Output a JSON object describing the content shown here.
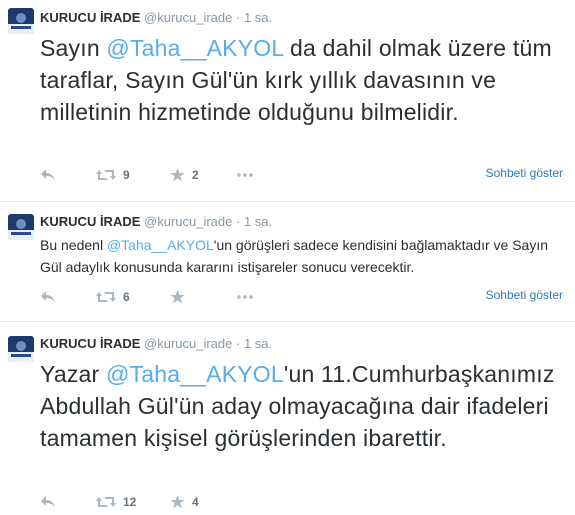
{
  "tweets": [
    {
      "name": "KURUCU İRADE",
      "handle": "@kurucu_irade",
      "separator": "·",
      "time": "1 sa.",
      "text_before": "Sayın ",
      "mention": "@Taha__AKYOL",
      "text_after": " da dahil olmak üzere tüm taraflar, Sayın Gül'ün kırk yıllık davasının ve milletinin hizmetinde olduğunu bilmelidir.",
      "retweets": "9",
      "favorites": "2",
      "expand_label": "Sohbeti göster"
    },
    {
      "name": "KURUCU İRADE",
      "handle": "@kurucu_irade",
      "separator": "·",
      "time": "1 sa.",
      "text_before": "Bu nedenl ",
      "mention": "@Taha__AKYOL",
      "text_after": "'un görüşleri sadece kendisini bağlamaktadır ve Sayın Gül adaylık konusunda kararını istişareler sonucu verecektir.",
      "retweets": "6",
      "favorites": "",
      "expand_label": "Sohbeti göster"
    },
    {
      "name": "KURUCU İRADE",
      "handle": "@kurucu_irade",
      "separator": "·",
      "time": "1 sa.",
      "text_before": "Yazar ",
      "mention": "@Taha__AKYOL",
      "text_after": "'un 11.Cumhurbaşkanımız Abdullah Gül'ün aday olmayacağına dair ifadeleri tamamen kişisel görüşlerinden ibarettir.",
      "retweets": "12",
      "favorites": "4",
      "expand_label": ""
    }
  ],
  "colors": {
    "mention": "#55acee",
    "link": "#2b7bb9",
    "icon": "#aab8c2",
    "separator": "#e1e8ed"
  },
  "icons": [
    "reply-icon",
    "retweet-icon",
    "favorite-icon",
    "more-icon"
  ]
}
